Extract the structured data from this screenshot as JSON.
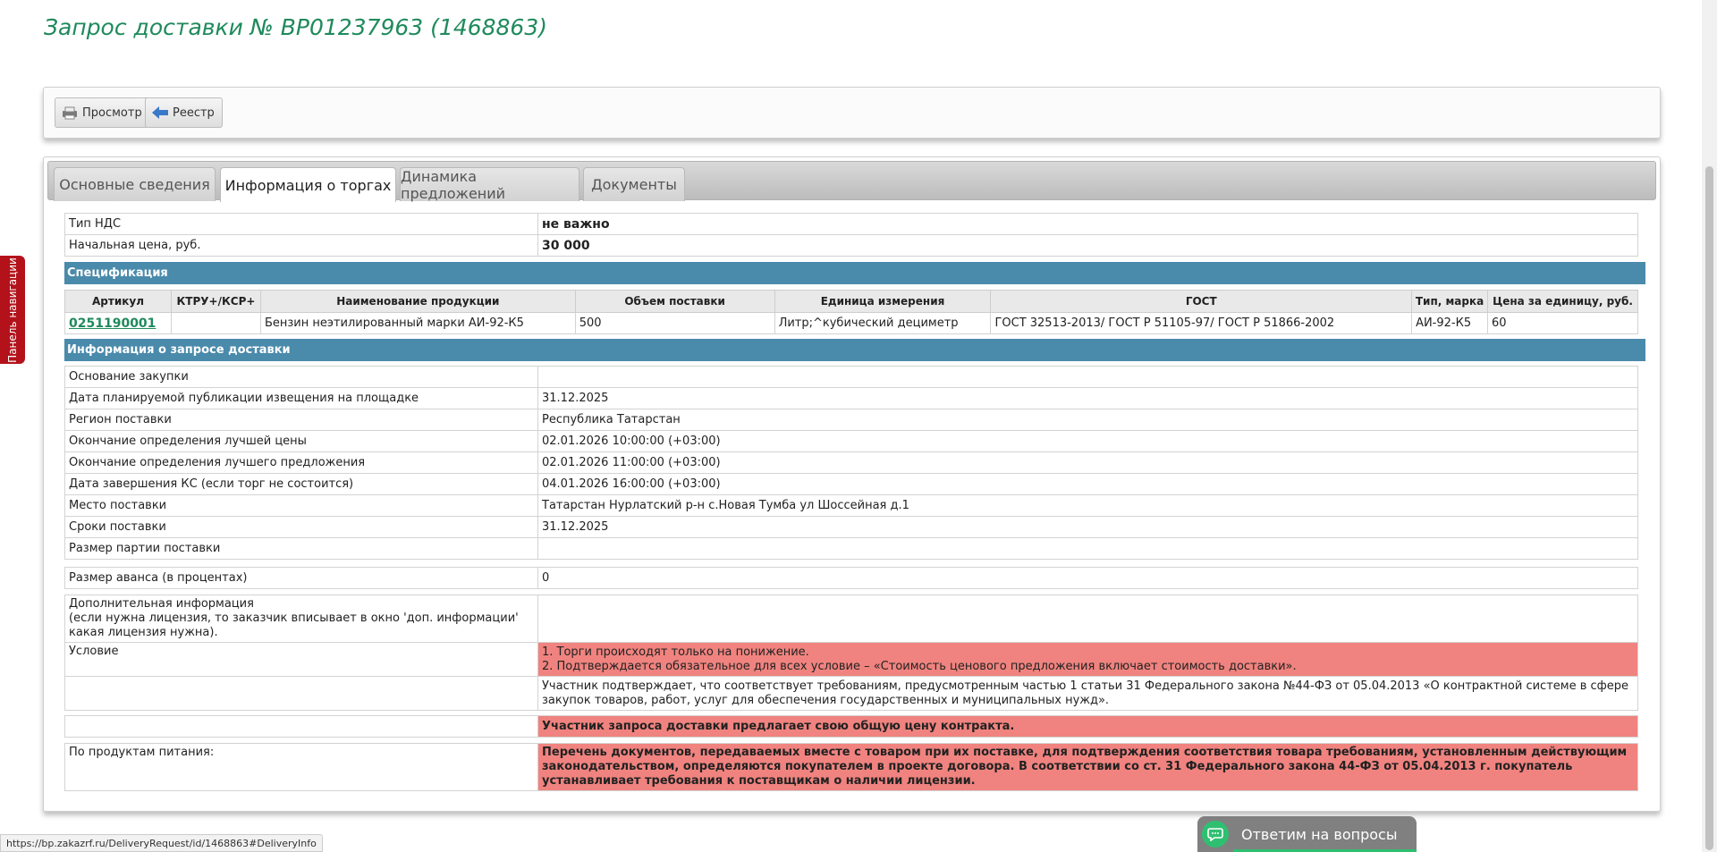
{
  "title": "Запрос доставки № ВР01237963 (1468863)",
  "toolbar": {
    "view_label": "Просмотр",
    "registry_label": "Реестр"
  },
  "tabs": [
    "Основные сведения",
    "Информация о торгах",
    "Динамика предложений",
    "Документы"
  ],
  "top_info": [
    {
      "label": "Тип НДС",
      "value": "не важно"
    },
    {
      "label": "Начальная цена, руб.",
      "value": "30 000"
    }
  ],
  "spec_title": "Спецификация",
  "spec_headers": [
    "Артикул",
    "КТРУ+/КСР+",
    "Наименование продукции",
    "Объем поставки",
    "Единица измерения",
    "ГОСТ",
    "Тип, марка",
    "Цена за единицу, руб."
  ],
  "spec_row": {
    "article": "0251190001",
    "ktru": "",
    "name": "Бензин неэтилированный марки АИ-92-К5",
    "volume": "500",
    "unit": "Литр;^кубический дециметр",
    "gost": "ГОСТ 32513-2013/ ГОСТ Р 51105-97/ ГОСТ Р 51866-2002",
    "brand": "АИ-92-К5",
    "price": "60"
  },
  "request_title": "Информация о запросе доставки",
  "request_rows": [
    {
      "label": "Основание закупки",
      "value": ""
    },
    {
      "label": "Дата планируемой публикации извещения на площадке",
      "value": "31.12.2025"
    },
    {
      "label": "Регион поставки",
      "value": "Республика Татарстан"
    },
    {
      "label": "Окончание определения лучшей цены",
      "value": "02.01.2026 10:00:00 (+03:00)"
    },
    {
      "label": "Окончание определения лучшего предложения",
      "value": "02.01.2026 11:00:00 (+03:00)"
    },
    {
      "label": "Дата завершения КС (если торг не состоится)",
      "value": "04.01.2026 16:00:00 (+03:00)"
    },
    {
      "label": "Место поставки",
      "value": "Татарстан Нурлатский р-н с.Новая Тумба ул Шоссейная д.1"
    },
    {
      "label": "Сроки поставки",
      "value": "31.12.2025"
    },
    {
      "label": "Размер партии поставки",
      "value": ""
    }
  ],
  "advance": {
    "label": "Размер аванса (в процентах)",
    "value": "0"
  },
  "additional": {
    "label_line1": "Дополнительная информация",
    "label_line2": "(если нужна лицензия, то заказчик вписывает в окно 'доп. информации'",
    "label_line3": "какая лицензия нужна).",
    "value": ""
  },
  "condition": {
    "label": "Условие",
    "line1": "1. Торги происходят только на понижение.",
    "line2": "2. Подтверждается обязательное для всех условие – «Стоимость ценового предложения включает стоимость доставки».",
    "participant": "Участник подтверждает, что соответствует требованиям, предусмотренным частью 1 статьи 31 Федерального закона №44-ФЗ от 05.04.2013 «О контрактной системе в сфере закупок товаров, работ, услуг для обеспечения государственных и муниципальных нужд».",
    "common_price": "Участник запроса доставки предлагает свою общую цену контракта."
  },
  "food": {
    "label": "По продуктам питания:",
    "value": "Перечень документов, передаваемых вместе с товаром при их поставке, для подтверждения соответствия товара требованиям, установленным действующим законодательством, определяются покупателем в проекте договора. В соответствии со ст. 31 Федерального закона 44-ФЗ от 05.04.2013 г. покупатель устанавливает требования к поставщикам о наличии лицензии."
  },
  "nav_panel_label": "Панель навигации",
  "chat_label": "Ответим на вопросы",
  "status_url": "https://bp.zakazrf.ru/DeliveryRequest/id/1468863#DeliveryInfo",
  "colors": {
    "title_green": "#1f8a5c",
    "section_blue": "#4a8aab",
    "warn_red": "#f0837f",
    "nav_red": "#b3121b",
    "chat_green": "#2fbf71"
  }
}
